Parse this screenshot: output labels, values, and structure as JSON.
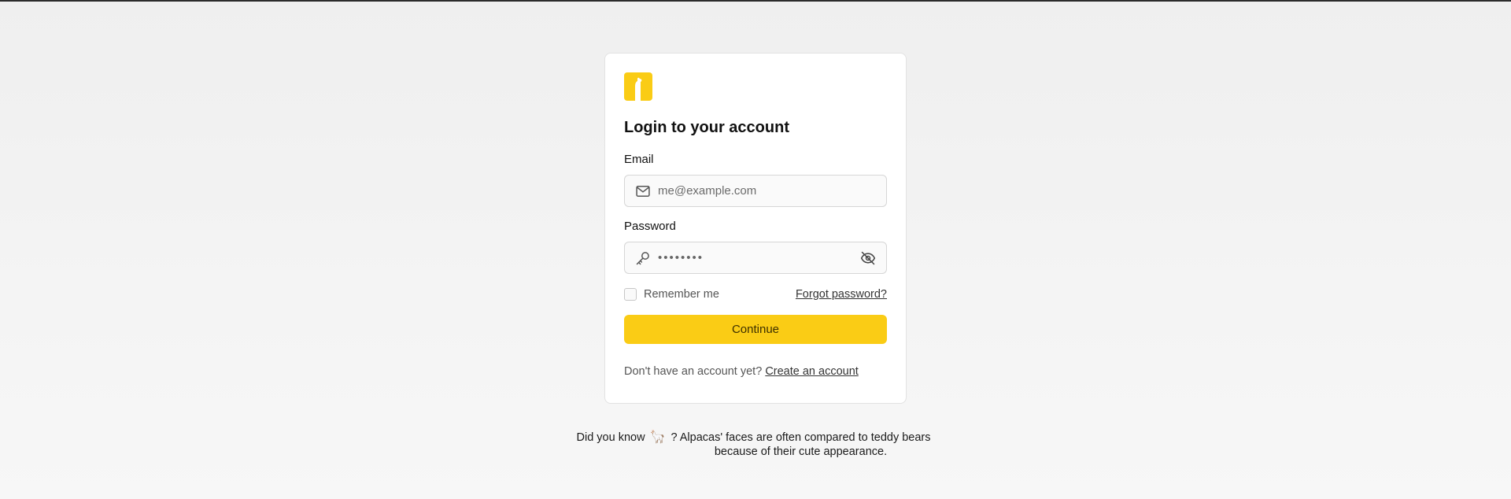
{
  "login": {
    "title": "Login to your account",
    "email_label": "Email",
    "email_placeholder": "me@example.com",
    "password_label": "Password",
    "password_value": "password",
    "remember_label": "Remember me",
    "remember_checked": false,
    "forgot_link": "Forgot password?",
    "continue_label": "Continue",
    "signup_prompt": "Don't have an account yet?",
    "signup_link": "Create an account"
  },
  "tip": {
    "prefix": "Did you know",
    "emoji": "🦙",
    "text": "? Alpacas' faces are often compared to teddy bears because of their cute appearance."
  },
  "icons": {
    "logo": "alpaca-logo-icon",
    "email": "mail-icon",
    "password": "key-icon",
    "toggle_visibility": "eye-off-icon"
  },
  "colors": {
    "accent": "#facc15",
    "background": "#f2f2f2",
    "card": "#ffffff"
  }
}
